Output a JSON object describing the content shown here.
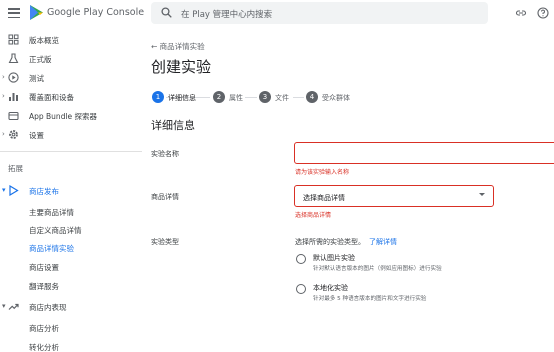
{
  "header": {
    "brand": "Google Play Console",
    "search_placeholder": "在 Play 管理中心内搜索"
  },
  "sidebar": {
    "items": [
      {
        "label": "版本概览",
        "icon": "grid-icon"
      },
      {
        "label": "正式版",
        "icon": "flask-icon"
      },
      {
        "label": "测试",
        "icon": "play-circle-icon"
      },
      {
        "label": "覆盖面和设备",
        "icon": "bar-chart-icon"
      },
      {
        "label": "App Bundle 探索器",
        "icon": "package-icon"
      },
      {
        "label": "设置",
        "icon": "gear-icon"
      }
    ],
    "section_title": "拓展",
    "store_presence": {
      "label": "商店发布",
      "sub_items": [
        "主要商品详情",
        "自定义商品详情",
        "商品详情实验",
        "商店设置",
        "翻译服务"
      ]
    },
    "store_performance": {
      "label": "商店内表现",
      "sub_items": [
        "商店分析",
        "转化分析"
      ]
    }
  },
  "main": {
    "breadcrumb": "商品详情实验",
    "title": "创建实验",
    "steps": [
      {
        "num": "1",
        "label": "详细信息"
      },
      {
        "num": "2",
        "label": "属性"
      },
      {
        "num": "3",
        "label": "文件"
      },
      {
        "num": "4",
        "label": "受众群体"
      }
    ],
    "section_title": "详细信息",
    "name_label": "实验名称",
    "name_error": "请为该实验输入名称",
    "listing_label": "商品详情",
    "listing_value": "选择商品详情",
    "listing_error": "选择商品详情",
    "type_label": "实验类型",
    "type_desc": "选择所需的实验类型。",
    "learn_more": "了解详情",
    "options": [
      {
        "title": "默认图片实验",
        "desc": "针对默认语言版本的图片（例如应用图标）进行实验"
      },
      {
        "title": "本地化实验",
        "desc": "针对最多 5 种语言版本的图片和文字进行实验"
      }
    ]
  },
  "colors": {
    "accent": "#1a73e8",
    "error": "#d93025"
  }
}
